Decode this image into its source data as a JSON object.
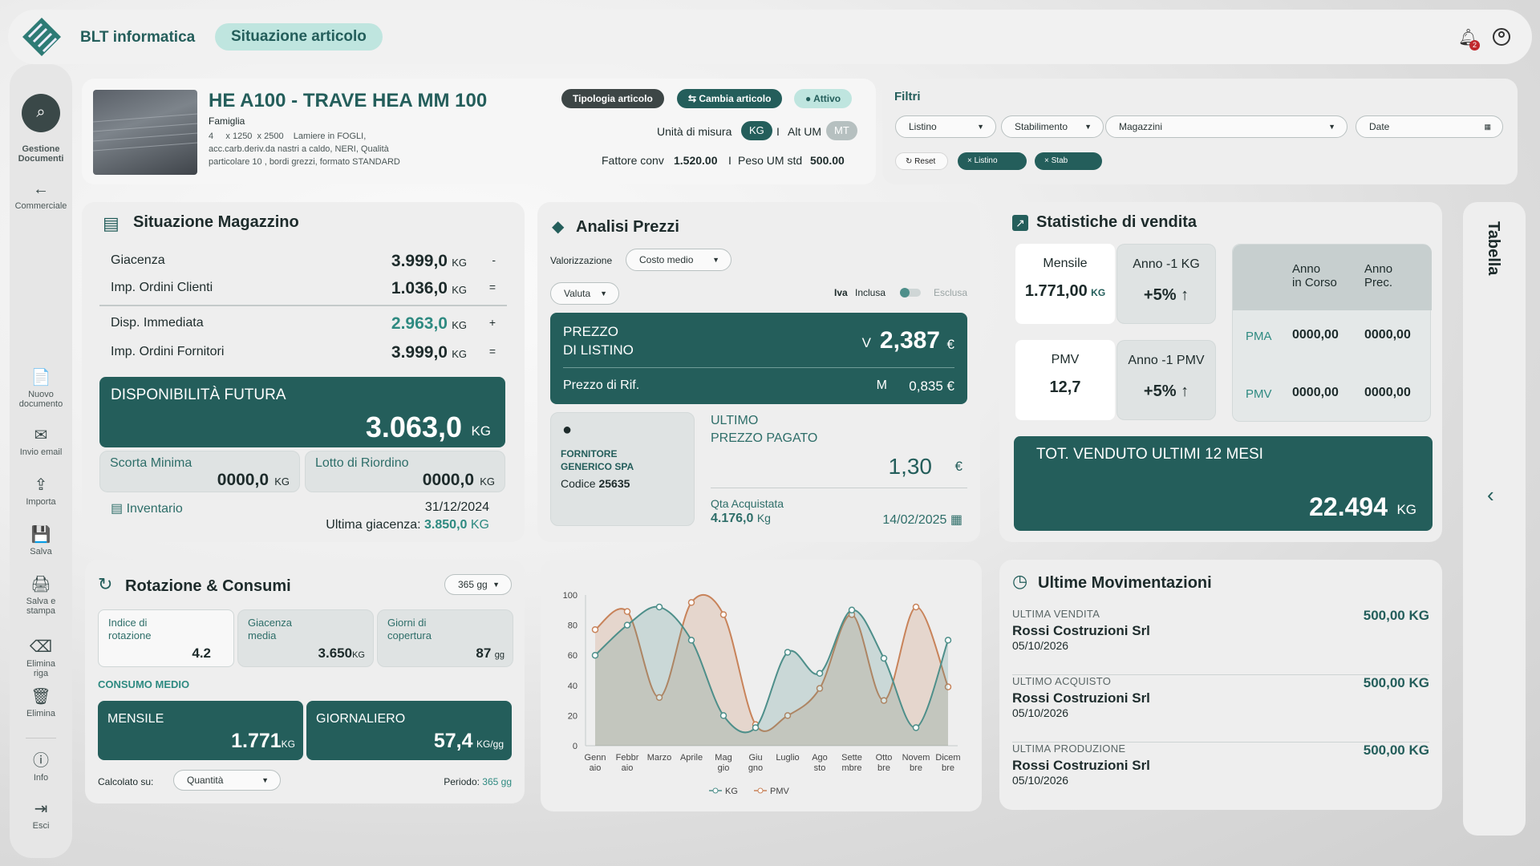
{
  "header": {
    "app_name": "BLT informatica",
    "page_tab": "Situazione articolo",
    "notif_count": "2"
  },
  "sidebar": {
    "search_label": "Gestione Documenti",
    "back_label": "Commerciale",
    "actions": [
      {
        "icon": "📄",
        "label": "Nuovo documento"
      },
      {
        "icon": "✉",
        "label": "Invio email"
      },
      {
        "icon": "⇪",
        "label": "Importa"
      },
      {
        "icon": "💾",
        "label": "Salva"
      },
      {
        "icon": "🖨",
        "label": "Salva e stampa"
      },
      {
        "icon": "⌫",
        "label": "Elimina riga"
      },
      {
        "icon": "🗑",
        "label": "Elimina"
      }
    ],
    "info_label": "Info",
    "exit_label": "Esci"
  },
  "article": {
    "code_title": "HE A100 - TRAVE HEA MM 100",
    "family_label": "Famiglia",
    "desc1": "4     x 1250  x 2500    Lamiere in FOGLI,",
    "desc2": "acc.carb.deriv.da nastri a caldo, NERI, Qualità",
    "desc3": "particolare 10 , bordi grezzi, formato STANDARD",
    "type_btn": "Tipologia articolo",
    "change_btn": "Cambia articolo",
    "status": "Attivo",
    "um_label": "Unità di misura",
    "um_value": "KG",
    "alt_um_label": "Alt UM",
    "alt_um_value": "MT",
    "sep": "I",
    "conv_label": "Fattore conv",
    "conv_value": "1.520.00",
    "peso_label": "Peso UM std",
    "peso_value": "500.00"
  },
  "filters": {
    "title": "Filtri",
    "listino": "Listino",
    "stabilimento": "Stabilimento",
    "magazzini": "Magazzini",
    "date": "Date",
    "reset": "Reset",
    "chip1": "Listino",
    "chip2": "Stab"
  },
  "magazzino": {
    "title": "Situazione Magazzino",
    "rows": [
      {
        "label": "Giacenza",
        "value": "3.999,0",
        "unit": "KG",
        "sign": "-"
      },
      {
        "label": "Imp. Ordini Clienti",
        "value": "1.036,0",
        "unit": "KG",
        "sign": "="
      },
      {
        "label": "Disp. Immediata",
        "value": "2.963,0",
        "unit": "KG",
        "sign": "+"
      },
      {
        "label": "Imp. Ordini Fornitori",
        "value": "3.999,0",
        "unit": "KG",
        "sign": "="
      }
    ],
    "future_label": "DISPONIBILITÀ FUTURA",
    "future_value": "3.063,0",
    "future_unit": "KG",
    "scorta_label": "Scorta Minima",
    "scorta_value": "0000,0",
    "scorta_unit": "KG",
    "lotto_label": "Lotto di Riordino",
    "lotto_value": "0000,0",
    "lotto_unit": "KG",
    "inv_label": "Inventario",
    "inv_date": "31/12/2024",
    "last_label": "Ultima giacenza:",
    "last_value": "3.850,0",
    "last_unit": "KG"
  },
  "prezzi": {
    "title": "Analisi Prezzi",
    "val_label": "Valorizzazione",
    "val_select": "Costo medio",
    "valuta_select": "Valuta",
    "iva_label": "Iva",
    "inclusa": "Inclusa",
    "esclusa": "Esclusa",
    "listino_l1": "PREZZO",
    "listino_l2": "DI LISTINO",
    "listino_tag": "V",
    "listino_value": "2,387",
    "listino_cur": "€",
    "rif_label": "Prezzo di Rif.",
    "rif_tag": "M",
    "rif_value": "0,835 €",
    "supplier_name1": "FORNITORE",
    "supplier_name2": "GENERICO SPA",
    "codice_label": "Codice",
    "codice_value": "25635",
    "last_l1": "ULTIMO",
    "last_l2": "PREZZO PAGATO",
    "last_value": "1,30",
    "last_cur": "€",
    "qta_label": "Qta Acquistata",
    "qta_value": "4.176,0",
    "qta_unit": "Kg",
    "qta_date": "14/02/2025"
  },
  "stats": {
    "title": "Statistiche di vendita",
    "mensile_label": "Mensile",
    "mensile_value": "1.771,00",
    "mensile_unit": "KG",
    "anno1kg_label": "Anno -1 KG",
    "anno1kg_value": "+5% ↑",
    "pmv_label": "PMV",
    "pmv_value": "12,7",
    "anno1pmv_label": "Anno -1 PMV",
    "anno1pmv_value": "+5% ↑",
    "col1": "Anno\nin Corso",
    "col2": "Anno\nPrec.",
    "pma_label": "PMA",
    "pma1": "0000,00",
    "pma2": "0000,00",
    "pmv2_label": "PMV",
    "pmv_c1": "0000,00",
    "pmv_c2": "0000,00",
    "tot_label": "TOT. VENDUTO ULTIMI 12 MESI",
    "tot_value": "22.494",
    "tot_unit": "KG"
  },
  "side_panel": {
    "label": "Tabella"
  },
  "rotazione": {
    "title": "Rotazione & Consumi",
    "period_select": "365 gg",
    "indice_label": "Indice di rotazione",
    "indice_value": "4.2",
    "giacenza_label": "Giacenza media",
    "giacenza_value": "3.650",
    "giacenza_unit": "KG",
    "giorni_label": "Giorni di copertura",
    "giorni_value": "87",
    "giorni_unit": "gg",
    "consumo_label": "CONSUMO MEDIO",
    "mensile_label": "MENSILE",
    "mensile_value": "1.771",
    "mensile_unit": "KG",
    "giorn_label": "GIORNALIERO",
    "giorn_value": "57,4",
    "giorn_unit": "KG/gg",
    "calc_label": "Calcolato su:",
    "calc_select": "Quantità",
    "periodo_label": "Periodo:",
    "periodo_value": "365 gg"
  },
  "chart_data": {
    "type": "area",
    "categories": [
      "Genn aio",
      "Febbr aio",
      "Marzo",
      "Aprile",
      "Mag gio",
      "Giu gno",
      "Luglio",
      "Ago sto",
      "Sette mbre",
      "Otto bre",
      "Novem bre",
      "Dicem bre"
    ],
    "yticks": [
      0,
      20,
      40,
      60,
      80,
      100
    ],
    "ylim": [
      0,
      100
    ],
    "legend": "bottom",
    "series": [
      {
        "name": "KG",
        "color": "#4e8f8a",
        "values": [
          60,
          80,
          92,
          70,
          20,
          12,
          62,
          48,
          90,
          58,
          12,
          70
        ]
      },
      {
        "name": "PMV",
        "color": "#c8835a",
        "values": [
          77,
          89,
          32,
          95,
          87,
          14,
          20,
          38,
          87,
          30,
          92,
          39
        ]
      }
    ]
  },
  "movimentazioni": {
    "title": "Ultime Movimentazioni",
    "items": [
      {
        "type": "ULTIMA VENDITA",
        "name": "Rossi Costruzioni Srl",
        "date": "05/10/2026",
        "qty": "500,00 KG"
      },
      {
        "type": "ULTIMO ACQUISTO",
        "name": "Rossi Costruzioni Srl",
        "date": "05/10/2026",
        "qty": "500,00 KG"
      },
      {
        "type": "ULTIMA PRODUZIONE",
        "name": "Rossi Costruzioni Srl",
        "date": "05/10/2026",
        "qty": "500,00 KG"
      }
    ]
  }
}
